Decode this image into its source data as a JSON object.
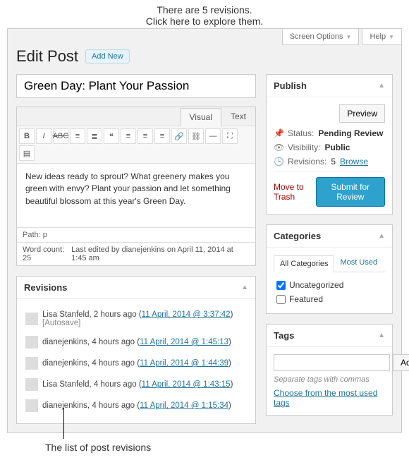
{
  "annotations": {
    "top_line1": "There are 5 revisions.",
    "top_line2": "Click here to explore them.",
    "bottom": "The list of post revisions"
  },
  "topbar": {
    "screen_options": "Screen Options",
    "help": "Help"
  },
  "page": {
    "heading": "Edit Post",
    "add_new": "Add New"
  },
  "editor": {
    "title": "Green Day: Plant Your Passion",
    "tabs": {
      "visual": "Visual",
      "text": "Text"
    },
    "content": "New ideas ready to sprout? What greenery makes you green with envy? Plant your passion and let something beautiful blossom at this year's Green Day.",
    "path": "Path: p",
    "word_count_label": "Word count:",
    "word_count": "25",
    "last_edited": "Last edited by dianejenkins on April 11, 2014 at 1:45 am"
  },
  "revisions_box": {
    "title": "Revisions",
    "items": [
      {
        "author": "Lisa Stanfeld",
        "ago": "2 hours ago",
        "ts": "11 April, 2014 @ 3:37:42",
        "suffix": "[Autosave]"
      },
      {
        "author": "dianejenkins",
        "ago": "4 hours ago",
        "ts": "11 April, 2014 @ 1:45:13",
        "suffix": ""
      },
      {
        "author": "dianejenkins",
        "ago": "4 hours ago",
        "ts": "11 April, 2014 @ 1:44:39",
        "suffix": ""
      },
      {
        "author": "Lisa Stanfeld",
        "ago": "4 hours ago",
        "ts": "11 April, 2014 @ 1:43:15",
        "suffix": ""
      },
      {
        "author": "dianejenkins",
        "ago": "4 hours ago",
        "ts": "11 April, 2014 @ 1:15:34",
        "suffix": ""
      }
    ]
  },
  "publish": {
    "title": "Publish",
    "preview": "Preview",
    "status_label": "Status:",
    "status_value": "Pending Review",
    "visibility_label": "Visibility:",
    "visibility_value": "Public",
    "revisions_label": "Revisions:",
    "revisions_count": "5",
    "browse": "Browse",
    "trash": "Move to Trash",
    "submit": "Submit for Review"
  },
  "categories": {
    "title": "Categories",
    "tab_all": "All Categories",
    "tab_most": "Most Used",
    "items": [
      {
        "label": "Uncategorized",
        "checked": true
      },
      {
        "label": "Featured",
        "checked": false
      }
    ]
  },
  "tags": {
    "title": "Tags",
    "add": "Add",
    "hint": "Separate tags with commas",
    "choose": "Choose from the most used tags"
  }
}
